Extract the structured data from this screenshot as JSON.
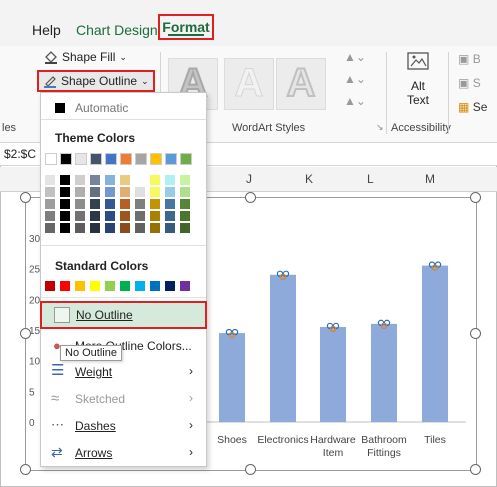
{
  "ribbon_tabs": {
    "help": "Help",
    "chart_design": "Chart Design",
    "format": "Format"
  },
  "ribbon": {
    "shape_fill": "Shape Fill",
    "shape_outline": "Shape Outline",
    "wordart_letter": "A",
    "wordart_group": "WordArt Styles",
    "alt_text_line1": "Alt",
    "alt_text_line2": "Text",
    "accessibility_group": "Accessibility",
    "left_group_fragment": "les",
    "right_fragment_1": "B",
    "right_fragment_2": "S",
    "right_fragment_3": "Se"
  },
  "formula_bar": {
    "name_box_fragment": "$2:$C"
  },
  "columns": [
    "J",
    "K",
    "L",
    "M"
  ],
  "outline_menu": {
    "automatic": "Automatic",
    "theme_colors_heading": "Theme Colors",
    "standard_colors_heading": "Standard Colors",
    "no_outline": "No Outline",
    "more_outline_colors": "More Outline Colors...",
    "weight": "Weight",
    "sketched": "Sketched",
    "dashes": "Dashes",
    "arrows": "Arrows",
    "theme_row": [
      "#ffffff",
      "#000000",
      "#e7e6e6",
      "#44546a",
      "#4472c4",
      "#ed7d31",
      "#a5a5a5",
      "#ffc000",
      "#5b9bd5",
      "#70ad47"
    ],
    "standard_row": [
      "#c00000",
      "#ff0000",
      "#ffc000",
      "#ffff00",
      "#92d050",
      "#00b050",
      "#00b0f0",
      "#0070c0",
      "#002060",
      "#7030a0"
    ]
  },
  "tooltip": "No Outline",
  "chart_data": {
    "type": "bar",
    "categories": [
      "Shoes",
      "Electronics",
      "Hardware Item",
      "Bathroom Fittings",
      "Tiles"
    ],
    "values": [
      145,
      240,
      155,
      160,
      255
    ],
    "ylim": [
      0,
      300
    ],
    "y_tick_fragments": [
      "30",
      "25",
      "20",
      "15",
      "10",
      "5",
      "0"
    ],
    "bar_color": "#8eaadb"
  },
  "accent": {
    "highlight_red": "#e02020",
    "format_green": "#1e6b3c"
  }
}
